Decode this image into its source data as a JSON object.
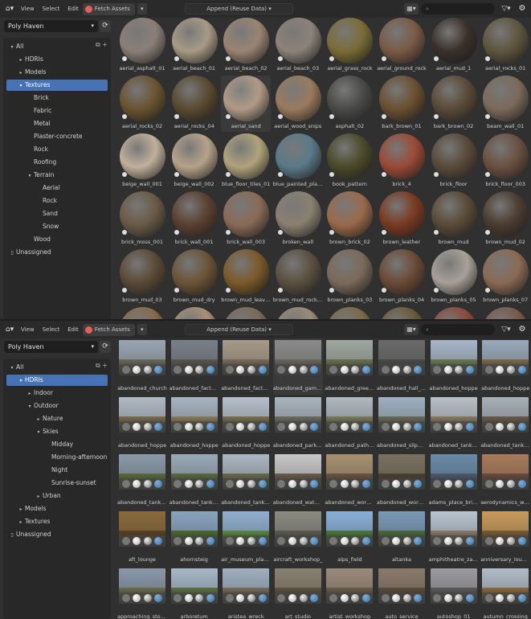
{
  "panels": [
    {
      "id": "top",
      "toolbar": {
        "view": "View",
        "select": "Select",
        "edit": "Edit",
        "fetch": "Fetch Assets",
        "append": "Append (Reuse Data)"
      },
      "library": "Poly Haven",
      "tree": [
        {
          "label": "All",
          "depth": 0,
          "arrow": "▾",
          "selected": false
        },
        {
          "label": "HDRIs",
          "depth": 1,
          "arrow": "▸",
          "selected": false
        },
        {
          "label": "Models",
          "depth": 1,
          "arrow": "▸",
          "selected": false
        },
        {
          "label": "Textures",
          "depth": 1,
          "arrow": "▾",
          "selected": true
        },
        {
          "label": "Brick",
          "depth": 2,
          "arrow": "",
          "selected": false
        },
        {
          "label": "Fabric",
          "depth": 2,
          "arrow": "",
          "selected": false
        },
        {
          "label": "Metal",
          "depth": 2,
          "arrow": "",
          "selected": false
        },
        {
          "label": "Plaster-concrete",
          "depth": 2,
          "arrow": "",
          "selected": false
        },
        {
          "label": "Rock",
          "depth": 2,
          "arrow": "",
          "selected": false
        },
        {
          "label": "Roofing",
          "depth": 2,
          "arrow": "",
          "selected": false
        },
        {
          "label": "Terrain",
          "depth": 2,
          "arrow": "▾",
          "selected": false
        },
        {
          "label": "Aerial",
          "depth": 3,
          "arrow": "",
          "selected": false
        },
        {
          "label": "Rock",
          "depth": 3,
          "arrow": "",
          "selected": false
        },
        {
          "label": "Sand",
          "depth": 3,
          "arrow": "",
          "selected": false
        },
        {
          "label": "Snow",
          "depth": 3,
          "arrow": "",
          "selected": false
        },
        {
          "label": "Wood",
          "depth": 2,
          "arrow": "",
          "selected": false
        },
        {
          "label": "Unassigned",
          "depth": 0,
          "arrow": "",
          "selected": false,
          "icon": true
        }
      ],
      "kind": "sphere",
      "assets": [
        {
          "name": "aerial_asphalt_01",
          "c": "#8a7f77"
        },
        {
          "name": "aerial_beach_01",
          "c": "#a89a86"
        },
        {
          "name": "aerial_beach_02",
          "c": "#9a8472"
        },
        {
          "name": "aerial_beach_03",
          "c": "#8c8278"
        },
        {
          "name": "aerial_grass_rock",
          "c": "#7a6c36"
        },
        {
          "name": "aerial_ground_rock",
          "c": "#7a5a46"
        },
        {
          "name": "aerial_mud_1",
          "c": "#3a302a"
        },
        {
          "name": "aerial_rocks_01",
          "c": "#5e553e"
        },
        {
          "name": "aerial_rocks_02",
          "c": "#6a5430"
        },
        {
          "name": "aerial_rocks_04",
          "c": "#5a4a30"
        },
        {
          "name": "aerial_sand",
          "c": "#b09a86",
          "hl": true
        },
        {
          "name": "aerial_wood_snips",
          "c": "#9a7a5e"
        },
        {
          "name": "asphalt_02",
          "c": "#4a4a48"
        },
        {
          "name": "bark_brown_01",
          "c": "#6a5030"
        },
        {
          "name": "bark_brown_02",
          "c": "#5a4a38"
        },
        {
          "name": "beam_wall_01",
          "c": "#7a6a5a"
        },
        {
          "name": "beige_wall_001",
          "c": "#c0b09a"
        },
        {
          "name": "beige_wall_002",
          "c": "#b6a28a"
        },
        {
          "name": "blue_floor_tiles_01",
          "c": "#b0a27a"
        },
        {
          "name": "blue_painted_plan...",
          "c": "#5a7a88"
        },
        {
          "name": "book_pattern",
          "c": "#4a4a2a"
        },
        {
          "name": "brick_4",
          "c": "#9a4a36"
        },
        {
          "name": "brick_floor",
          "c": "#5a4a3a"
        },
        {
          "name": "brick_floor_003",
          "c": "#6a5040"
        },
        {
          "name": "brick_moss_001",
          "c": "#6a5a46"
        },
        {
          "name": "brick_wall_001",
          "c": "#5a4030"
        },
        {
          "name": "brick_wall_003",
          "c": "#8a6a56"
        },
        {
          "name": "broken_wall",
          "c": "#8a8070"
        },
        {
          "name": "brown_brick_02",
          "c": "#9a6a4a"
        },
        {
          "name": "brown_leather",
          "c": "#7a3a20"
        },
        {
          "name": "brown_mud",
          "c": "#5a4a38"
        },
        {
          "name": "brown_mud_02",
          "c": "#4a3c30"
        },
        {
          "name": "brown_mud_03",
          "c": "#5a4a36"
        },
        {
          "name": "brown_mud_dry",
          "c": "#6a5436"
        },
        {
          "name": "brown_mud_leave...",
          "c": "#7a5a2a"
        },
        {
          "name": "brown_mud_rocks...",
          "c": "#5a5040"
        },
        {
          "name": "brown_planks_03",
          "c": "#7a6a5a"
        },
        {
          "name": "brown_planks_04",
          "c": "#6a4a36"
        },
        {
          "name": "brown_planks_05",
          "c": "#a8a098"
        },
        {
          "name": "brown_planks_07",
          "c": "#8a6a54"
        },
        {
          "name": "",
          "c": "#8a6a4a"
        },
        {
          "name": "",
          "c": "#a89078"
        },
        {
          "name": "",
          "c": "#7a6a5a"
        },
        {
          "name": "",
          "c": "#9a8a7a"
        },
        {
          "name": "",
          "c": "#7a6a4a"
        },
        {
          "name": "",
          "c": "#6a5a3a"
        },
        {
          "name": "",
          "c": "#8a4a3a"
        },
        {
          "name": "",
          "c": "#7a5a4a"
        }
      ]
    },
    {
      "id": "bottom",
      "toolbar": {
        "view": "View",
        "select": "Select",
        "edit": "Edit",
        "fetch": "Fetch Assets",
        "append": "Append (Reuse Data)"
      },
      "library": "Poly Haven",
      "tree": [
        {
          "label": "All",
          "depth": 0,
          "arrow": "▾",
          "selected": false
        },
        {
          "label": "HDRIs",
          "depth": 1,
          "arrow": "▾",
          "selected": true
        },
        {
          "label": "Indoor",
          "depth": 2,
          "arrow": "▸",
          "selected": false
        },
        {
          "label": "Outdoor",
          "depth": 2,
          "arrow": "▾",
          "selected": false
        },
        {
          "label": "Nature",
          "depth": 3,
          "arrow": "▸",
          "selected": false
        },
        {
          "label": "Skies",
          "depth": 3,
          "arrow": "▾",
          "selected": false
        },
        {
          "label": "Midday",
          "depth": 4,
          "arrow": "",
          "selected": false
        },
        {
          "label": "Morning-afternoon",
          "depth": 4,
          "arrow": "",
          "selected": false
        },
        {
          "label": "Night",
          "depth": 4,
          "arrow": "",
          "selected": false
        },
        {
          "label": "Sunrise-sunset",
          "depth": 4,
          "arrow": "",
          "selected": false
        },
        {
          "label": "Urban",
          "depth": 3,
          "arrow": "▸",
          "selected": false
        },
        {
          "label": "Models",
          "depth": 1,
          "arrow": "▸",
          "selected": false
        },
        {
          "label": "Textures",
          "depth": 1,
          "arrow": "▸",
          "selected": false
        },
        {
          "label": "Unassigned",
          "depth": 0,
          "arrow": "",
          "selected": false,
          "icon": true
        }
      ],
      "kind": "hdri",
      "assets": [
        {
          "name": "abandoned_church",
          "sky": "#9aa6b2",
          "gr": "#6a6a5a"
        },
        {
          "name": "abandoned_factor...",
          "sky": "#7a8088",
          "gr": "#5a5650"
        },
        {
          "name": "abandoned_factor...",
          "sky": "#a89a8a",
          "gr": "#7a6a5a"
        },
        {
          "name": "abandoned_game...",
          "sky": "#8a8a8a",
          "gr": "#6a665e",
          "hl": true
        },
        {
          "name": "abandoned_green...",
          "sky": "#a0a8a0",
          "gr": "#6a7050"
        },
        {
          "name": "abandoned_hall_01",
          "sky": "#6a6a6a",
          "gr": "#4a4a4a"
        },
        {
          "name": "abandoned_hoppe",
          "sky": "#a8b6c8",
          "gr": "#6a7a50"
        },
        {
          "name": "abandoned_hoppe",
          "sky": "#9aaaba",
          "gr": "#7a6a4a"
        },
        {
          "name": "abandoned_hoppe",
          "sky": "#b0bac4",
          "gr": "#7a6a50"
        },
        {
          "name": "abandoned_hoppe",
          "sky": "#a8b4c0",
          "gr": "#8a7a5a"
        },
        {
          "name": "abandoned_hoppe",
          "sky": "#b6c0ca",
          "gr": "#7a7050"
        },
        {
          "name": "abandoned_parking",
          "sky": "#aab4be",
          "gr": "#6a6a60"
        },
        {
          "name": "abandoned_pathw...",
          "sky": "#b0b8c0",
          "gr": "#7a7a5a"
        },
        {
          "name": "abandoned_slipway",
          "sky": "#a0b0c0",
          "gr": "#6a6a5a"
        },
        {
          "name": "abandoned_tank_f...",
          "sky": "#b8c0c8",
          "gr": "#8a7a60"
        },
        {
          "name": "abandoned_tank_f...",
          "sky": "#a8b0b8",
          "gr": "#6a5a4a"
        },
        {
          "name": "abandoned_tank_f...",
          "sky": "#8a9aa8",
          "gr": "#5a6a3a"
        },
        {
          "name": "abandoned_tank_f...",
          "sky": "#9aaab8",
          "gr": "#5a6a40"
        },
        {
          "name": "abandoned_tank_f...",
          "sky": "#aab6c2",
          "gr": "#6a6a50"
        },
        {
          "name": "abandoned_water...",
          "sky": "#c8c8c8",
          "gr": "#6a5a4a"
        },
        {
          "name": "abandoned_works...",
          "sky": "#a89070",
          "gr": "#6a5440"
        },
        {
          "name": "abandoned_works...",
          "sky": "#7a7060",
          "gr": "#4a4030"
        },
        {
          "name": "adams_place_brid...",
          "sky": "#6a8aa8",
          "gr": "#4a5a6a"
        },
        {
          "name": "aerodynamics_wo...",
          "sky": "#a87a5a",
          "gr": "#6a4a3a"
        },
        {
          "name": "aft_lounge",
          "sky": "#8a6a3a",
          "gr": "#5a4020"
        },
        {
          "name": "ahornsteig",
          "sky": "#8aa4c0",
          "gr": "#4a6a30"
        },
        {
          "name": "air_museum_play...",
          "sky": "#90b0d0",
          "gr": "#5a8a40"
        },
        {
          "name": "aircraft_workshop_",
          "sky": "#8a8a80",
          "gr": "#5a5a50"
        },
        {
          "name": "alps_field",
          "sky": "#8ab0d8",
          "gr": "#4a7a3a"
        },
        {
          "name": "altanka",
          "sky": "#7a9ab8",
          "gr": "#4a6a3a"
        },
        {
          "name": "amphitheatre_zan...",
          "sky": "#b8c4d0",
          "gr": "#8a7a6a"
        },
        {
          "name": "anniversary_lounge",
          "sky": "#c89a5a",
          "gr": "#7a5a30"
        },
        {
          "name": "approaching_storm",
          "sky": "#8a98a8",
          "gr": "#6a6a4a"
        },
        {
          "name": "arboretum",
          "sky": "#a8b8c8",
          "gr": "#5a7040"
        },
        {
          "name": "aristea_wreck",
          "sky": "#a0b0c0",
          "gr": "#7a6a5a"
        },
        {
          "name": "art_studio",
          "sky": "#8a8070",
          "gr": "#5a5040"
        },
        {
          "name": "artist_workshop",
          "sky": "#9a8a7a",
          "gr": "#6a5a4a"
        },
        {
          "name": "auto_service",
          "sky": "#8a7a6a",
          "gr": "#5a4a3a"
        },
        {
          "name": "autoshop_01",
          "sky": "#9a9aa0",
          "gr": "#5a5a5a"
        },
        {
          "name": "autumn_crossing",
          "sky": "#b0bcc8",
          "gr": "#8a6a3a"
        }
      ]
    }
  ]
}
